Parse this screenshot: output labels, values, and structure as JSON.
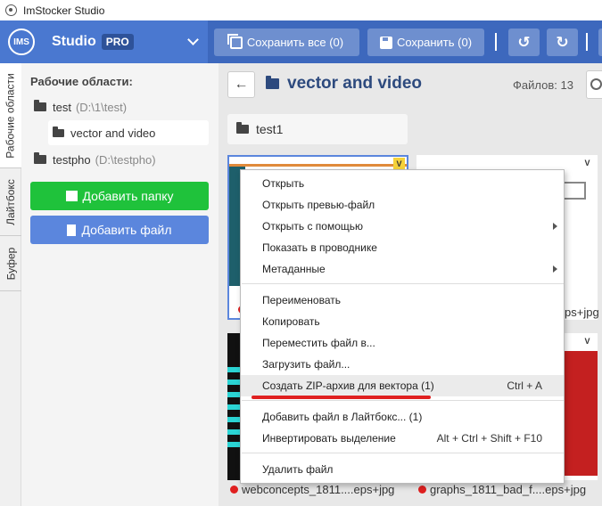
{
  "window": {
    "title": "ImStocker Studio"
  },
  "brand": {
    "logo": "IMS",
    "name": "Studio",
    "badge": "PRO"
  },
  "toolbar": {
    "save_all": "Сохранить все (0)",
    "save": "Сохранить (0)",
    "undo_icon": "undo-icon",
    "redo_icon": "redo-icon"
  },
  "side_tabs": [
    "Рабочие области",
    "Лайтбокс",
    "Буфер"
  ],
  "workspaces": {
    "title": "Рабочие области:",
    "items": [
      {
        "name": "test",
        "path": "(D:\\1\\test)"
      },
      {
        "name": "vector and video",
        "path": ""
      },
      {
        "name": "testpho",
        "path": "(D:\\testpho)"
      }
    ],
    "add_folder": "Добавить папку",
    "add_file": "Добавить файл"
  },
  "main": {
    "folder_title": "vector and video",
    "file_count": "Файлов: 13",
    "subfolder": "test1",
    "thumb_badge": "V",
    "captions": [
      "ps+jpg",
      "webconcepts_1811....eps+jpg",
      "graphs_1811_bad_f....eps+jpg"
    ]
  },
  "context_menu": {
    "items": [
      {
        "label": "Открыть",
        "shortcut": ""
      },
      {
        "label": "Открыть превью-файл",
        "shortcut": ""
      },
      {
        "label": "Открыть с помощью",
        "shortcut": ""
      },
      {
        "label": "Показать в проводнике",
        "shortcut": ""
      },
      {
        "label": "Метаданные",
        "shortcut": ""
      },
      {
        "label": "Переименовать",
        "shortcut": ""
      },
      {
        "label": "Копировать",
        "shortcut": ""
      },
      {
        "label": "Переместить файл в...",
        "shortcut": ""
      },
      {
        "label": "Загрузить файл...",
        "shortcut": ""
      },
      {
        "label": "Создать ZIP-архив для вектора (1)",
        "shortcut": "Ctrl + A"
      },
      {
        "label": "Добавить файл в Лайтбокс... (1)",
        "shortcut": ""
      },
      {
        "label": "Инвертировать выделение",
        "shortcut": "Alt + Ctrl + Shift + F10"
      },
      {
        "label": "Удалить файл",
        "shortcut": ""
      }
    ]
  },
  "colors": {
    "accent": "#4a78d0",
    "green": "#1fc23b",
    "highlight_underline": "#e02020"
  }
}
